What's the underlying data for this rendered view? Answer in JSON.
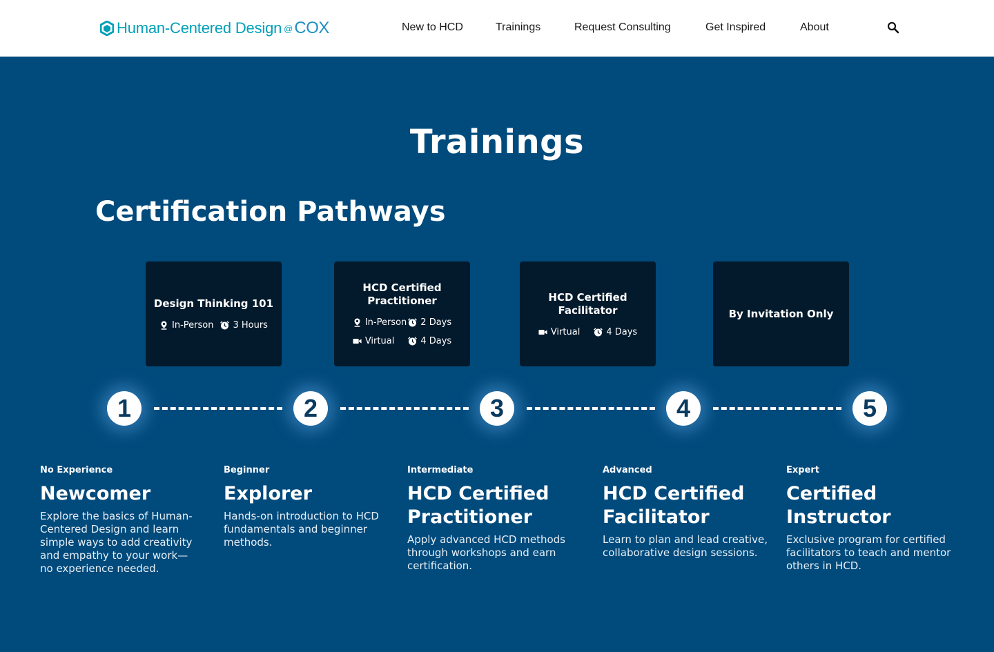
{
  "header": {
    "logo": {
      "brand": "Human-Centered Design",
      "at": "@",
      "company": "COX"
    },
    "nav": [
      {
        "label": "New to HCD"
      },
      {
        "label": "Trainings"
      },
      {
        "label": "Request Consulting"
      },
      {
        "label": "Get Inspired"
      },
      {
        "label": "About"
      }
    ],
    "search_icon": "search-icon"
  },
  "page_title": "Trainings",
  "section_title": "Certification Pathways",
  "cards": [
    {
      "title": "Design Thinking 101",
      "rows": [
        [
          {
            "icon": "location-icon",
            "text": "In-Person"
          },
          {
            "icon": "clock-icon",
            "text": "3 Hours"
          }
        ]
      ]
    },
    {
      "title": "HCD Certified Practitioner",
      "rows": [
        [
          {
            "icon": "location-icon",
            "text": "In-Person"
          },
          {
            "icon": "clock-icon",
            "text": "2 Days"
          }
        ],
        [
          {
            "icon": "video-icon",
            "text": "Virtual"
          },
          {
            "icon": "clock-icon",
            "text": "4 Days"
          }
        ]
      ]
    },
    {
      "title": "HCD Certified Facilitator",
      "rows": [
        [
          {
            "icon": "video-icon",
            "text": "Virtual"
          },
          {
            "icon": "clock-icon",
            "text": "4 Days"
          }
        ]
      ]
    },
    {
      "title": "By Invitation Only",
      "rows": []
    }
  ],
  "steps": [
    "1",
    "2",
    "3",
    "4",
    "5"
  ],
  "levels": [
    {
      "tag": "No Experience",
      "title": "Newcomer",
      "desc": "Explore the basics of Human-Centered Design and learn simple ways to add creativity and empathy to your work—no experience needed."
    },
    {
      "tag": "Beginner",
      "title": "Explorer",
      "desc": "Hands-on introduction to HCD fundamentals and beginner methods."
    },
    {
      "tag": "Intermediate",
      "title": "HCD Certified Practitioner",
      "desc": "Apply advanced HCD methods through workshops and earn certification."
    },
    {
      "tag": "Advanced",
      "title": "HCD Certified Facilitator",
      "desc": "Learn to plan and lead creative, collaborative design sessions."
    },
    {
      "tag": "Expert",
      "title": "Certified Instructor",
      "desc": "Exclusive program for certified facilitators to teach and mentor others in HCD."
    }
  ],
  "colors": {
    "background": "#004a7c",
    "card": "#031a2c",
    "accent": "#00a0b8"
  }
}
